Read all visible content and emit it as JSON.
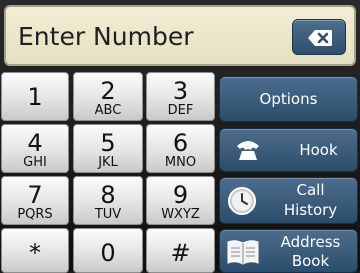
{
  "entry": {
    "placeholder": "Enter Number"
  },
  "keypad": {
    "keys": [
      {
        "digit": "1",
        "letters": ""
      },
      {
        "digit": "2",
        "letters": "ABC"
      },
      {
        "digit": "3",
        "letters": "DEF"
      },
      {
        "digit": "4",
        "letters": "GHI"
      },
      {
        "digit": "5",
        "letters": "JKL"
      },
      {
        "digit": "6",
        "letters": "MNO"
      },
      {
        "digit": "7",
        "letters": "PQRS"
      },
      {
        "digit": "8",
        "letters": "TUV"
      },
      {
        "digit": "9",
        "letters": "WXYZ"
      },
      {
        "digit": "*",
        "letters": ""
      },
      {
        "digit": "0",
        "letters": ""
      },
      {
        "digit": "#",
        "letters": ""
      }
    ]
  },
  "side_buttons": {
    "options": {
      "label": "Options"
    },
    "hook": {
      "label": "Hook",
      "icon": "phone-handset-icon"
    },
    "call_history": {
      "label_line1": "Call",
      "label_line2": "History",
      "icon": "clock-icon"
    },
    "address_book": {
      "label_line1": "Address",
      "label_line2": "Book",
      "icon": "book-icon"
    }
  },
  "colors": {
    "field": "#eae4c8",
    "accent_blue": "#3b5c7c",
    "key_face": "#e8e8e8"
  }
}
